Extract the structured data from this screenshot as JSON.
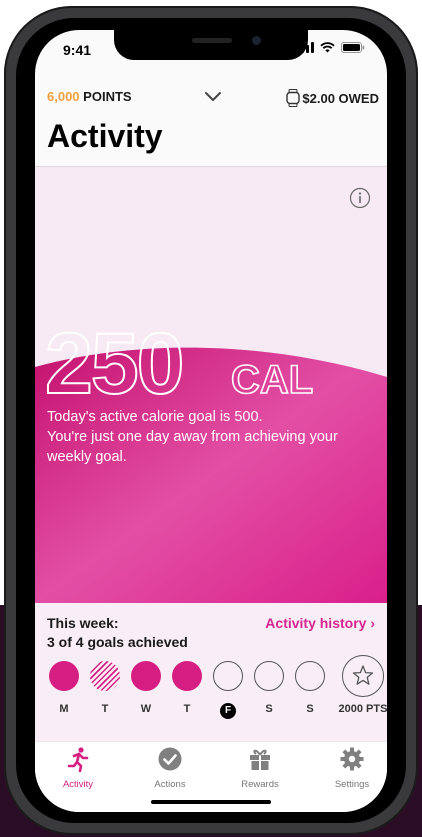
{
  "status": {
    "time": "9:41"
  },
  "header": {
    "points_value": "6,000",
    "points_label": "POINTS",
    "owed_label": "$2.00 OWED"
  },
  "page": {
    "title": "Activity"
  },
  "hero": {
    "calories_value": "250",
    "calories_unit": "CAL",
    "goal_text_line1": "Today's active calorie goal is 500.",
    "goal_text_line2": "You're just one day away from achieving your weekly goal."
  },
  "week": {
    "label": "This week:",
    "goals_achieved": "3 of 4 goals achieved",
    "history_link": "Activity history ›",
    "days": [
      {
        "letter": "M",
        "state": "filled"
      },
      {
        "letter": "T",
        "state": "hatched"
      },
      {
        "letter": "W",
        "state": "filled"
      },
      {
        "letter": "T",
        "state": "filled"
      },
      {
        "letter": "F",
        "state": "today"
      },
      {
        "letter": "S",
        "state": "empty"
      },
      {
        "letter": "S",
        "state": "empty"
      }
    ],
    "reward_points": "2000 PTS"
  },
  "tabs": [
    {
      "label": "Activity",
      "icon": "runner-icon",
      "active": true
    },
    {
      "label": "Actions",
      "icon": "check-circle-icon",
      "active": false
    },
    {
      "label": "Rewards",
      "icon": "gift-icon",
      "active": false
    },
    {
      "label": "Settings",
      "icon": "gear-icon",
      "active": false
    }
  ],
  "colors": {
    "accent": "#d61e82",
    "points": "#f0a03c"
  }
}
